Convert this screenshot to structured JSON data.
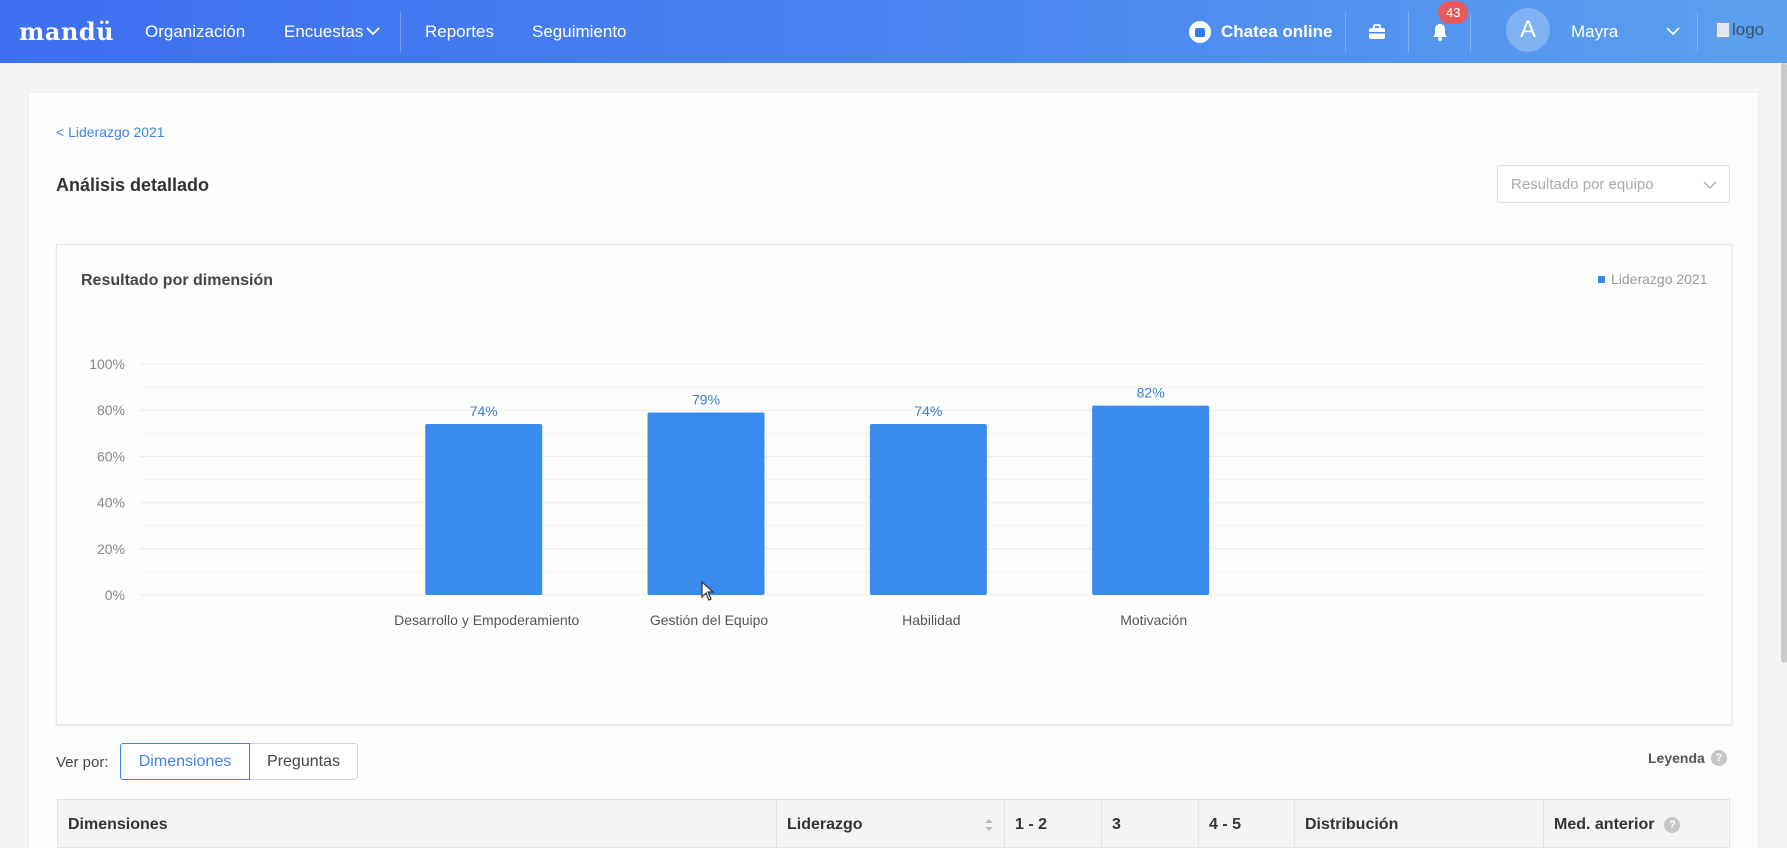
{
  "nav": {
    "brand": "mandü",
    "items": [
      "Organización",
      "Encuestas",
      "Reportes",
      "Seguimiento"
    ],
    "chat_label": "Chatea online",
    "notification_count": "43",
    "avatar_letter": "A",
    "user_name": "Mayra",
    "logo_alt": "logo"
  },
  "page": {
    "back_link": "< Liderazgo 2021",
    "title": "Análisis detallado",
    "select_placeholder": "Resultado por equipo"
  },
  "chart": {
    "title": "Resultado por dimensión",
    "legend_label": "Liderazgo 2021"
  },
  "chart_data": {
    "type": "bar",
    "categories": [
      "Desarrollo y Empoderamiento",
      "Gestión del Equipo",
      "Habilidad",
      "Motivación"
    ],
    "values": [
      74,
      79,
      74,
      82
    ],
    "value_labels": [
      "74%",
      "79%",
      "74%",
      "82%"
    ],
    "series": [
      {
        "name": "Liderazgo 2021",
        "values": [
          74,
          79,
          74,
          82
        ]
      }
    ],
    "yticks": [
      "0%",
      "20%",
      "40%",
      "60%",
      "80%",
      "100%"
    ],
    "ylim": [
      0,
      100
    ],
    "grid": true,
    "legend_position": "top-right",
    "bar_color": "#3a8bee"
  },
  "view": {
    "label": "Ver por:",
    "options": [
      "Dimensiones",
      "Preguntas"
    ],
    "selected": "Dimensiones",
    "legend_link": "Leyenda"
  },
  "table": {
    "headers": [
      "Dimensiones",
      "Liderazgo",
      "1 - 2",
      "3",
      "4 - 5",
      "Distribución",
      "Med. anterior"
    ]
  },
  "colors": {
    "accent": "#3c84e6",
    "bar": "#3a8bee",
    "badge": "#e75a5a"
  }
}
